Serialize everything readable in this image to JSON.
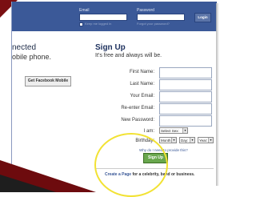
{
  "header": {
    "email_label": "Email",
    "password_label": "Password",
    "keep_logged_in": "Keep me logged in",
    "forgot_password": "Forgot your password?",
    "login_button": "Login"
  },
  "left": {
    "connected_text": "nected",
    "mobile_text": "obile phone.",
    "mobile_button": "Get Facebook Mobile"
  },
  "signup": {
    "title": "Sign Up",
    "subtitle": "It’s free and always will be.",
    "fields": [
      {
        "label": "First Name:"
      },
      {
        "label": "Last Name:"
      },
      {
        "label": "Your Email:"
      },
      {
        "label": "Re-enter Email:"
      },
      {
        "label": "New Password:"
      }
    ],
    "iam_label": "I am:",
    "sex_select": "Select Sex:",
    "birthday_label": "Birthday:",
    "month_select": "Month:",
    "day_select": "Day:",
    "year_select": "Year:",
    "why_link": "Why do I need to provide this?",
    "submit_button": "Sign Up",
    "create_page_prefix": "Create a Page",
    "create_page_suffix": " for a celebrity, band or business."
  },
  "colors": {
    "facebook_blue": "#3b5998",
    "signup_green": "#69a74e",
    "highlight_yellow": "#f2e233",
    "slide_accent_red": "#7a0f12"
  }
}
